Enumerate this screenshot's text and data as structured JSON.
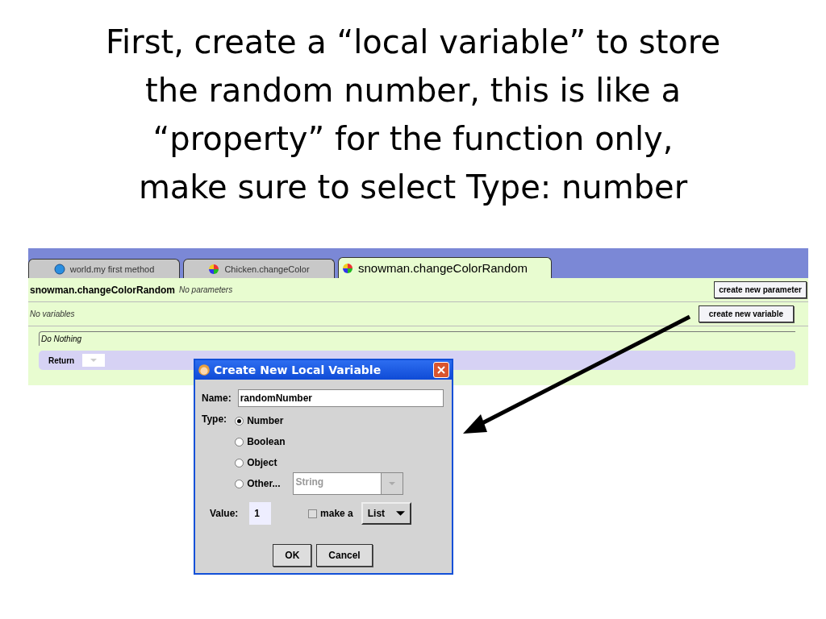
{
  "slide_title": [
    "First, create a “local variable” to store",
    "the random number, this is like a",
    "“property” for the function only,",
    "make sure to select Type: number"
  ],
  "tabs": [
    {
      "label": "world.my first method",
      "kind": "world",
      "selected": false
    },
    {
      "label": "Chicken.changeColor",
      "kind": "color",
      "selected": false
    },
    {
      "label": "snowman.changeColorRandom",
      "kind": "color",
      "selected": true
    }
  ],
  "method": {
    "name": "snowman.changeColorRandom",
    "parameters_note": "No parameters",
    "parameter_button": "create new parameter",
    "variables_note": "No variables",
    "variable_button": "create new variable",
    "do_nothing": "Do Nothing",
    "return_label": "Return"
  },
  "dialog": {
    "title": "Create New Local Variable",
    "name_label": "Name:",
    "name_value": "randomNumber",
    "type_label": "Type:",
    "type_options": [
      {
        "label": "Number",
        "selected": true
      },
      {
        "label": "Boolean",
        "selected": false
      },
      {
        "label": "Object",
        "selected": false
      },
      {
        "label": "Other...",
        "selected": false
      }
    ],
    "other_type": "String",
    "value_label": "Value:",
    "value": "1",
    "make_a_label": "make a",
    "make_a_checked": false,
    "collection": "List",
    "buttons": [
      "OK",
      "Cancel"
    ]
  }
}
